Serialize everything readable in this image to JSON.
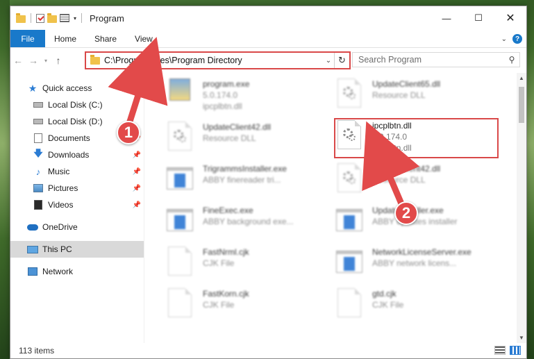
{
  "window": {
    "title": "Program"
  },
  "ribbon": {
    "tabs": [
      "File",
      "Home",
      "Share",
      "View"
    ]
  },
  "navigation": {
    "address": "C:\\Program Files\\Program Directory",
    "search_placeholder": "Search Program"
  },
  "sidebar": {
    "items": [
      {
        "label": "Quick access",
        "icon": "star-icon",
        "pinned": false
      },
      {
        "label": "Local Disk (C:)",
        "icon": "drive-icon",
        "pinned": false
      },
      {
        "label": "Local Disk (D:)",
        "icon": "drive-icon",
        "pinned": false
      },
      {
        "label": "Documents",
        "icon": "documents-icon",
        "pinned": true
      },
      {
        "label": "Downloads",
        "icon": "download-icon",
        "pinned": true
      },
      {
        "label": "Music",
        "icon": "music-icon",
        "pinned": true
      },
      {
        "label": "Pictures",
        "icon": "pictures-icon",
        "pinned": true
      },
      {
        "label": "Videos",
        "icon": "videos-icon",
        "pinned": true
      },
      {
        "label": "OneDrive",
        "icon": "cloud-icon",
        "pinned": false
      },
      {
        "label": "This PC",
        "icon": "computer-icon",
        "pinned": false,
        "selected": true
      },
      {
        "label": "Network",
        "icon": "network-icon",
        "pinned": false
      }
    ]
  },
  "files": [
    {
      "name": "program.exe",
      "line2": "5.0.174.0",
      "line3": "ipcplbtn.dll",
      "icon": "exe-icon",
      "blurred": true
    },
    {
      "name": "UpdateClient65.dll",
      "line2": "Resource DLL",
      "line3": "",
      "icon": "dll-icon",
      "blurred": true
    },
    {
      "name": "UpdateClient42.dll",
      "line2": "Resource DLL",
      "line3": "",
      "icon": "dll-icon",
      "blurred": true
    },
    {
      "name": "ipcplbtn.dll",
      "line2": "5.0.174.0",
      "line3": "ipcplbtn.dll",
      "icon": "dll-icon",
      "blurred": false
    },
    {
      "name": "TrigrammsInstaller.exe",
      "line2": "ABBY finereader tri...",
      "line3": "",
      "icon": "app-icon",
      "blurred": true
    },
    {
      "name": "UpdateClient42.dll",
      "line2": "Resource DLL",
      "line3": "",
      "icon": "dll-icon",
      "blurred": true
    },
    {
      "name": "FineExec.exe",
      "line2": "ABBY background exe...",
      "line3": "",
      "icon": "app-icon",
      "blurred": true
    },
    {
      "name": "UpdateInstaller.exe",
      "line2": "ABBY updates installer",
      "line3": "",
      "icon": "app-icon",
      "blurred": true
    },
    {
      "name": "FastNrml.cjk",
      "line2": "CJK File",
      "line3": "",
      "icon": "file-icon",
      "blurred": true
    },
    {
      "name": "NetworkLicenseServer.exe",
      "line2": "ABBY network licens...",
      "line3": "",
      "icon": "app-icon",
      "blurred": true
    },
    {
      "name": "FastKorn.cjk",
      "line2": "CJK File",
      "line3": "",
      "icon": "file-icon",
      "blurred": true
    },
    {
      "name": "gtd.cjk",
      "line2": "CJK File",
      "line3": "",
      "icon": "file-icon",
      "blurred": true
    }
  ],
  "annotations": {
    "badge_1": "1",
    "badge_2": "2",
    "color": "#e24a4a"
  },
  "status": {
    "item_count": "113 items"
  }
}
